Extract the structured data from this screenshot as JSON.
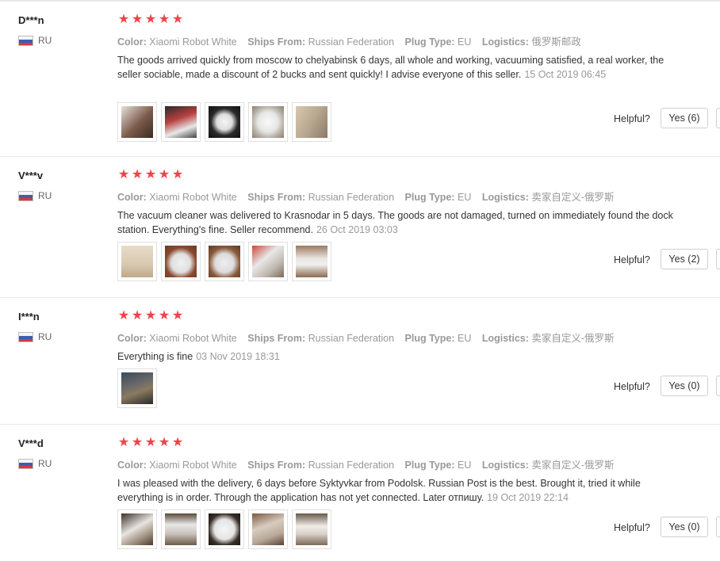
{
  "labels": {
    "color": "Color:",
    "ships_from": "Ships From:",
    "plug_type": "Plug Type:",
    "logistics": "Logistics:",
    "helpful": "Helpful?"
  },
  "colors": {
    "star": "#f0434b",
    "muted": "#999999",
    "text": "#333333"
  },
  "reviews": [
    {
      "buyer": "D***n",
      "country": "RU",
      "rating": 5,
      "color": "Xiaomi Robot White",
      "ships_from": "Russian Federation",
      "plug_type": "EU",
      "logistics": "俄罗斯邮政",
      "text": "The goods arrived quickly from moscow to chelyabinsk 6 days, all whole and working, vacuuming satisfied, a real worker, the seller sociable, made a discount of 2 bucks and sent quickly! I advise everyone of this seller.",
      "date": "15 Oct 2019 06:45",
      "photo_count": 5,
      "yes_label": "Yes (6)"
    },
    {
      "buyer": "V***v",
      "country": "RU",
      "rating": 5,
      "color": "Xiaomi Robot White",
      "ships_from": "Russian Federation",
      "plug_type": "EU",
      "logistics": "卖家自定义-俄罗斯",
      "text": "The vacuum cleaner was delivered to Krasnodar in 5 days. The goods are not damaged, turned on immediately found the dock station. Everything's fine. Seller recommend.",
      "date": "26 Oct 2019 03:03",
      "photo_count": 5,
      "yes_label": "Yes (2)"
    },
    {
      "buyer": "I***n",
      "country": "RU",
      "rating": 5,
      "color": "Xiaomi Robot White",
      "ships_from": "Russian Federation",
      "plug_type": "EU",
      "logistics": "卖家自定义-俄罗斯",
      "text": "Everything is fine",
      "date": "03 Nov 2019 18:31",
      "photo_count": 1,
      "yes_label": "Yes (0)"
    },
    {
      "buyer": "V***d",
      "country": "RU",
      "rating": 5,
      "color": "Xiaomi Robot White",
      "ships_from": "Russian Federation",
      "plug_type": "EU",
      "logistics": "卖家自定义-俄罗斯",
      "text": "I was pleased with the delivery, 6 days before Syktyvkar from Podolsk. Russian Post is the best. Brought it, tried it while everything is in order. Through the application has not yet connected. Later отпишу.",
      "date": "19 Oct 2019 22:14",
      "photo_count": 5,
      "yes_label": "Yes (0)"
    }
  ]
}
